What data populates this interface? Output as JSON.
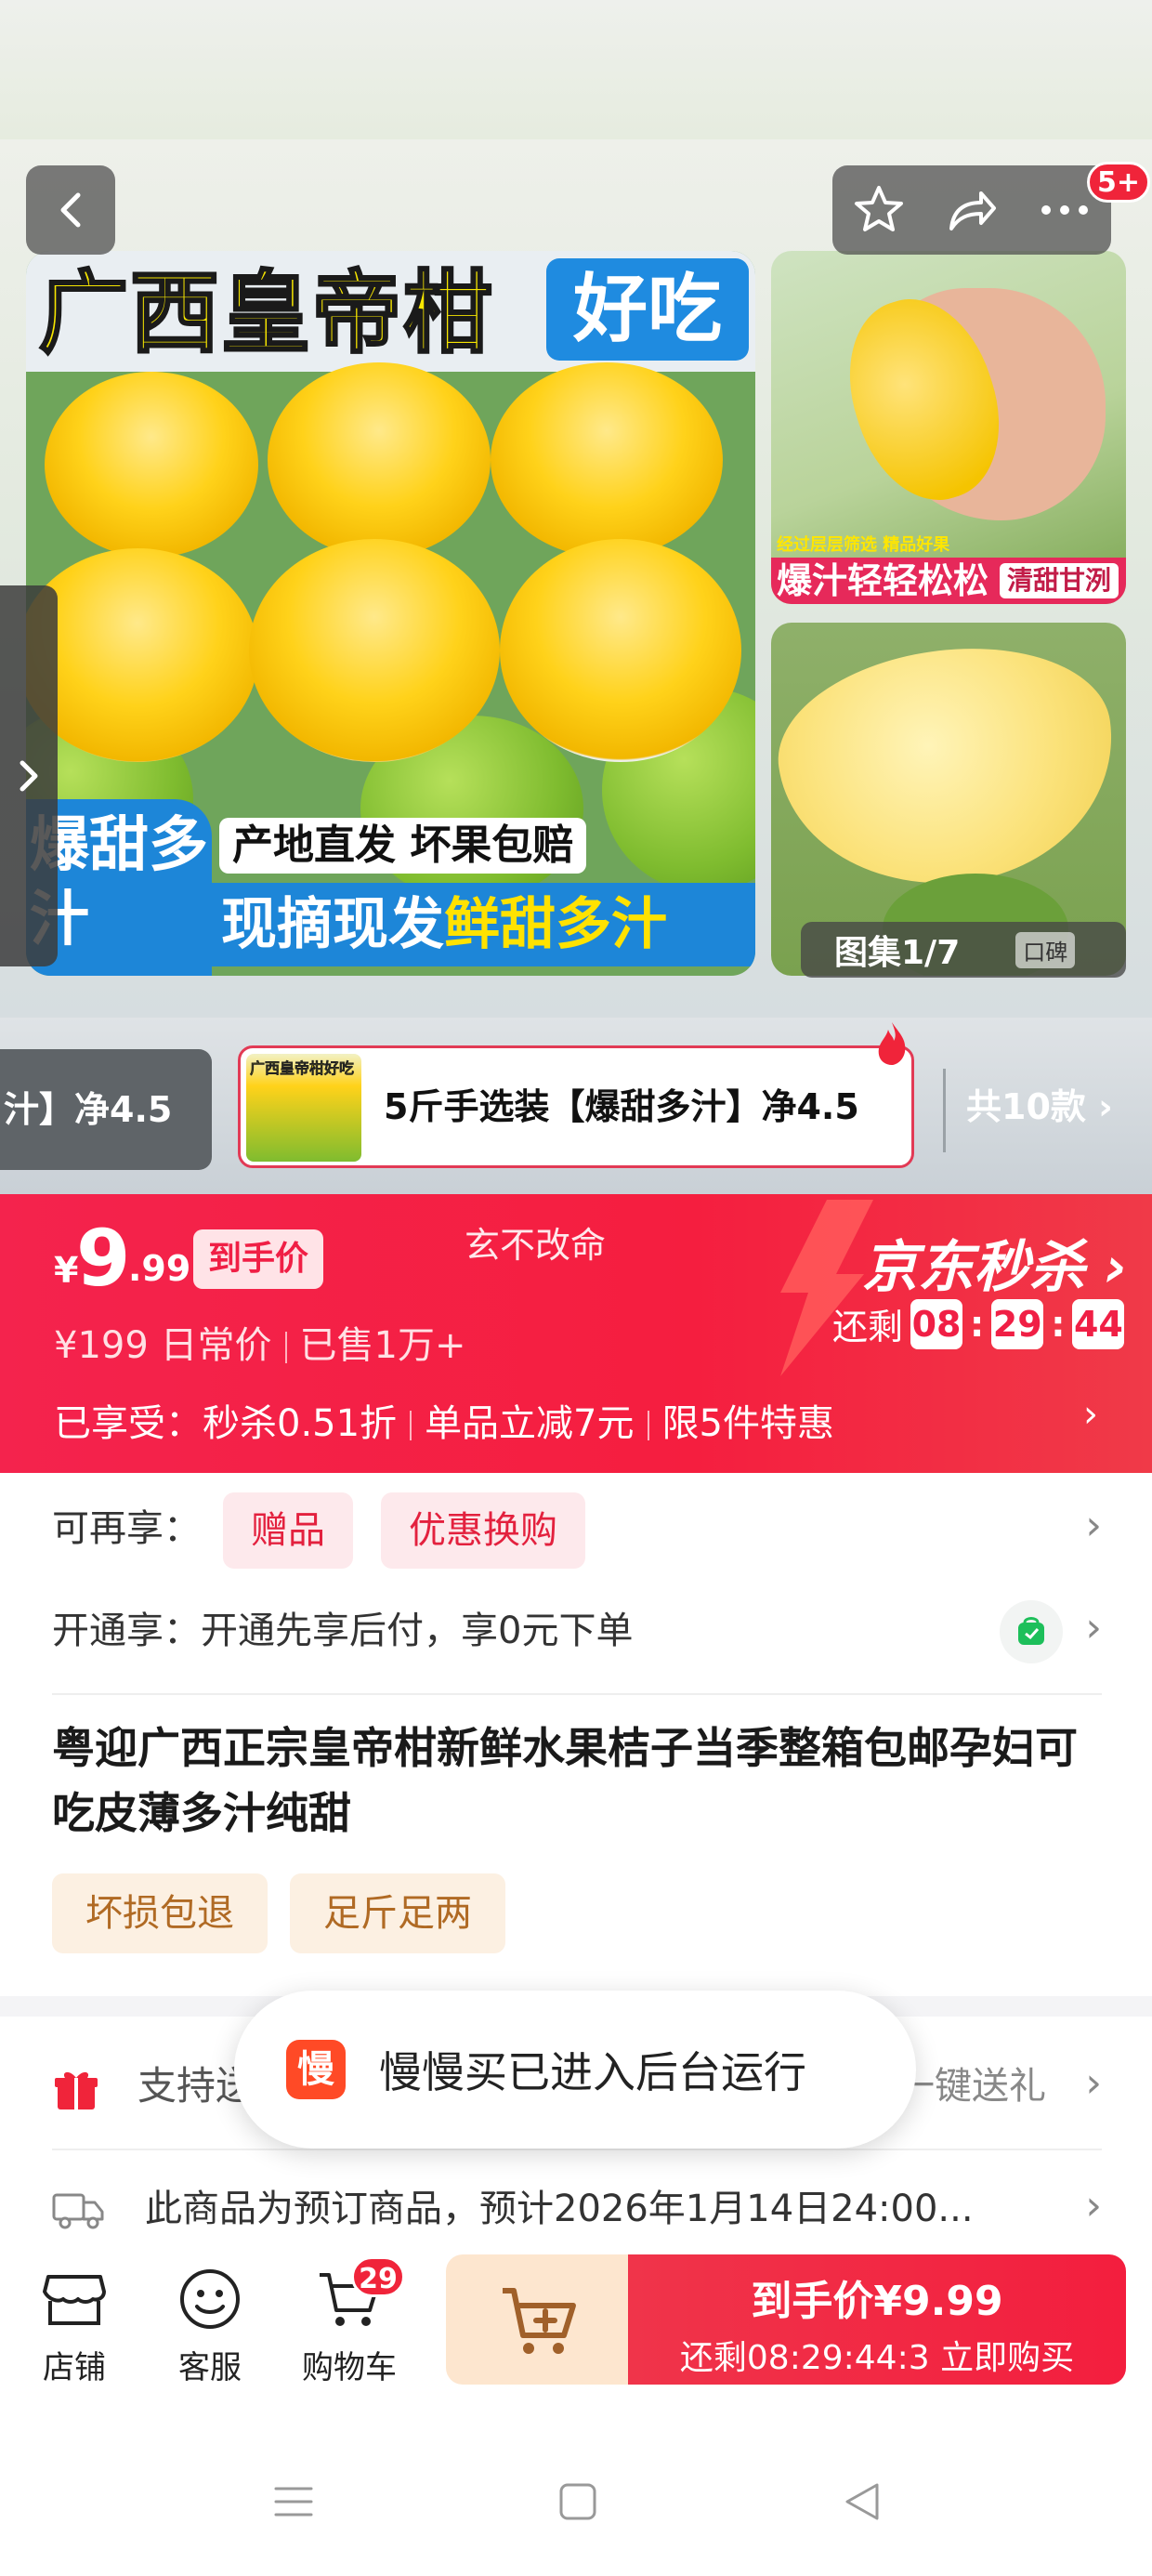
{
  "gallery": {
    "main_image": {
      "headline_left": "广西皇帝柑",
      "headline_right": "好吃",
      "corner_label": "爆甜多汁",
      "tag_origin": "产地直发 坏果包赔",
      "tag_fresh_white": "现摘现发",
      "tag_fresh_yellow": "鲜甜多汁"
    },
    "thumb1": {
      "small_text": "经过层层筛选 精品好果",
      "band_left": "爆汁轻轻松松",
      "band_right": "清甜甘洌"
    },
    "counter_label": "图集1/7",
    "counter_more": "口碑"
  },
  "top_bar": {
    "message_badge": "5+"
  },
  "variants": {
    "previous_label": "汁】净4.5",
    "current_thumb_text": "广西皇帝柑好吃",
    "current_label": "5斤手选装【爆甜多汁】净4.5",
    "total_label": "共10款 ›"
  },
  "flash_sale": {
    "currency": "¥",
    "price_int": "9",
    "price_dec": ".99",
    "price_tag": "到手价",
    "promo_text": "玄不改命",
    "daily_price": "¥199  日常价",
    "sold": "已售1万+",
    "brand": "京东秒杀 ›",
    "remaining_label": "还剩",
    "countdown": {
      "h": "08",
      "m": "29",
      "s": "44"
    },
    "benefit_label": "已享受：",
    "benefit_1": "秒杀0.51折",
    "benefit_2": "单品立减7元",
    "benefit_3": "限5件特惠",
    "colors": {
      "accent": "#f4234d"
    }
  },
  "extra_offers": {
    "label": "可再享：",
    "pill_1": "赠品",
    "pill_2": "优惠换购"
  },
  "open_pay": {
    "label": "开通享：开通先享后付，享0元下单"
  },
  "product": {
    "title": "粤迎广西正宗皇帝柑新鲜水果桔子当季整箱包邮孕妇可吃皮薄多汁纯甜",
    "badges": [
      "坏损包退",
      "足斤足两"
    ]
  },
  "gift_row": {
    "label": "支持送",
    "right": "一键送礼"
  },
  "preorder_row": {
    "label": "此商品为预订商品，预计2026年1月14日24:00..."
  },
  "toast": {
    "logo_text": "慢",
    "message": "慢慢买已进入后台运行"
  },
  "bottom_bar": {
    "shop": "店铺",
    "service": "客服",
    "cart": "购物车",
    "cart_count": "29",
    "buy_line1": "到手价¥9.99",
    "buy_line2": "还剩08:29:44:3  立即购买"
  }
}
